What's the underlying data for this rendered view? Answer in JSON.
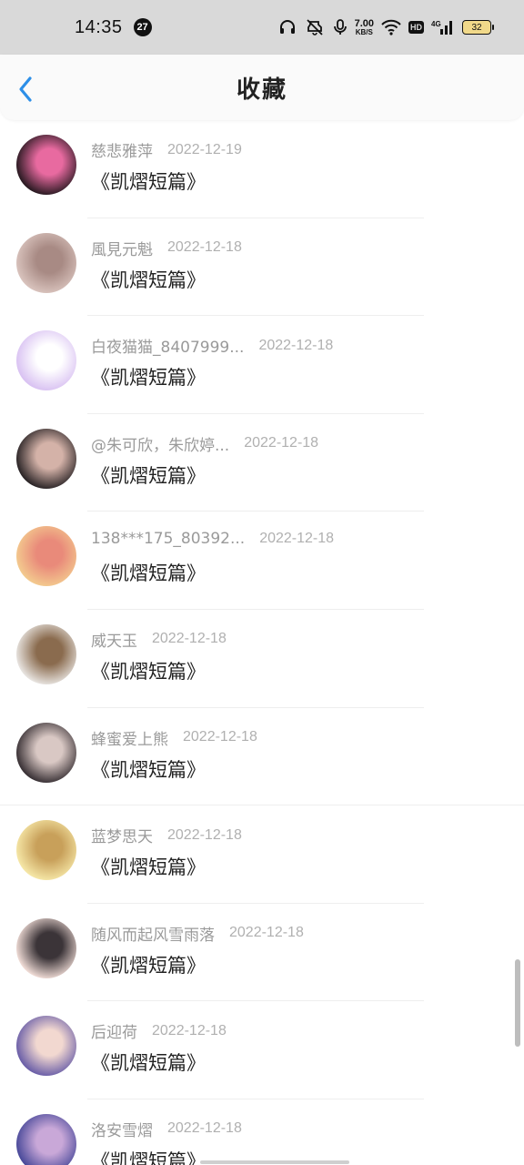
{
  "status_bar": {
    "time": "14:35",
    "notification_count": "27",
    "net_speed_value": "7.00",
    "net_speed_unit": "KB/S",
    "hd_label": "HD",
    "signal_label": "4G",
    "battery_level": "32"
  },
  "header": {
    "title": "收藏"
  },
  "favorites": [
    {
      "name": "慈悲雅萍",
      "date": "2022-12-19",
      "book": "《凯熠短篇》",
      "avatar_colors": [
        "#2a1a22",
        "#e86aa0"
      ]
    },
    {
      "name": "風見元魁",
      "date": "2022-12-18",
      "book": "《凯熠短篇》",
      "avatar_colors": [
        "#d8c2bc",
        "#a88a84"
      ]
    },
    {
      "name": "白夜猫猫_8407999...",
      "date": "2022-12-18",
      "book": "《凯熠短篇》",
      "avatar_colors": [
        "#d9c2f2",
        "#ffffff"
      ]
    },
    {
      "name": "@朱可欣，朱欣婷...",
      "date": "2022-12-18",
      "book": "《凯熠短篇》",
      "avatar_colors": [
        "#2b2527",
        "#d4b2a8"
      ]
    },
    {
      "name": "138***175_80392...",
      "date": "2022-12-18",
      "book": "《凯熠短篇》",
      "avatar_colors": [
        "#f3c98e",
        "#e98a7a"
      ]
    },
    {
      "name": "威天玉",
      "date": "2022-12-18",
      "book": "《凯熠短篇》",
      "avatar_colors": [
        "#e7e3df",
        "#8a6b4e"
      ]
    },
    {
      "name": "蜂蜜爱上熊",
      "date": "2022-12-18",
      "book": "《凯熠短篇》",
      "avatar_colors": [
        "#3a3236",
        "#d9c8c4"
      ]
    },
    {
      "name": "蓝梦思天",
      "date": "2022-12-18",
      "book": "《凯熠短篇》",
      "avatar_colors": [
        "#f5e6a6",
        "#c8a05a"
      ]
    },
    {
      "name": "随风而起风雪雨落",
      "date": "2022-12-18",
      "book": "《凯熠短篇》",
      "avatar_colors": [
        "#eedad4",
        "#3b3438"
      ]
    },
    {
      "name": "后迎荷",
      "date": "2022-12-18",
      "book": "《凯熠短篇》",
      "avatar_colors": [
        "#6b5fa8",
        "#f2d8d0"
      ]
    },
    {
      "name": "洛安雪熠",
      "date": "2022-12-18",
      "book": "《凯熠短篇》",
      "avatar_colors": [
        "#4a4a9a",
        "#c9a8d8"
      ]
    }
  ],
  "colors": {
    "accent_blue": "#2d8fe8",
    "status_bar_bg": "#d9d9d9",
    "name_text": "#9a9a9a",
    "date_text": "#b0b0b0"
  }
}
